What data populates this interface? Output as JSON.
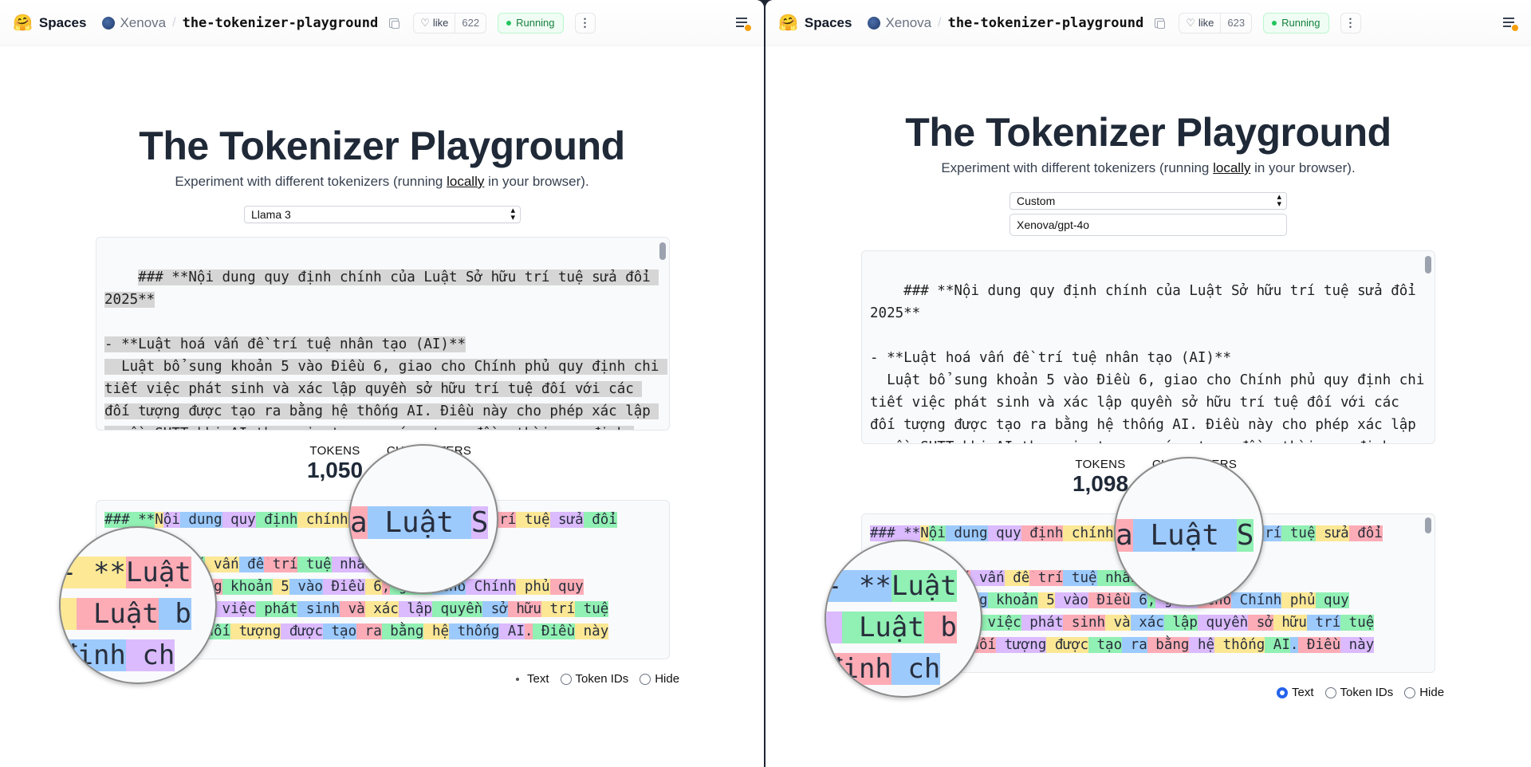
{
  "header": {
    "spaces": "Spaces",
    "org": "Xenova",
    "separator": "/",
    "repo": "the-tokenizer-playground",
    "like": "like",
    "status": "Running",
    "more": "⋮"
  },
  "left": {
    "like_count": "622",
    "model_select": "Llama 3",
    "tokens_value": "1,050",
    "magnifier_top_text": "a Luật S",
    "magnifier_left_lines": [
      "- **Luật",
      " Luật b",
      "định ch"
    ]
  },
  "right": {
    "like_count": "623",
    "model_select": "Custom",
    "custom_model": "Xenova/gpt-4o",
    "tokens_value": "1,098",
    "magnifier_top_text": "a Luật S",
    "magnifier_left_lines": [
      "- **Luật",
      " Luật b",
      "định ch"
    ]
  },
  "page": {
    "title": "The Tokenizer Playground",
    "subtitle_before": "Experiment with different tokenizers (running ",
    "subtitle_link": "locally",
    "subtitle_after": " in your browser).",
    "tokens_label": "TOKENS",
    "characters_label": "CHARACTERS",
    "radio_text": "Text",
    "radio_ids": "Token IDs",
    "radio_hide": "Hide"
  },
  "input_text": "### **Nội dung quy định chính của Luật Sở hữu trí tuệ sửa đổi 2025**\n\n- **Luật hoá vấn đề trí tuệ nhân tạo (AI)**\n  Luật bổ sung khoản 5 vào Điều 6, giao cho Chính phủ quy định chi tiết việc phát sinh và xác lập quyền sở hữu trí tuệ đối với các đối tượng được tạo ra bằng hệ thống AI. Điều này cho phép xác lập quyền SHTT khi AI tham gia tạo ra sáng tạo, đồng thời quy định việc sử dụng dữ liệu để huấn luyện AI.",
  "token_lines_left": [
    [
      [
        "### **",
        1
      ],
      [
        "N",
        2
      ],
      [
        "ội",
        4
      ],
      [
        " dung",
        3
      ],
      [
        " quy",
        4
      ],
      [
        " định",
        1
      ],
      [
        " chính",
        2
      ],
      [
        " của",
        0
      ],
      [
        " Luật",
        3
      ],
      [
        " Sở",
        4
      ],
      [
        " hữu",
        1
      ],
      [
        " trí",
        0
      ],
      [
        " tuệ",
        2
      ],
      [
        " sửa",
        4
      ],
      [
        " đổi",
        1
      ]
    ],
    [
      [
        "",
        0
      ]
    ],
    [
      [
        "- **",
        2
      ],
      [
        "Luật",
        0
      ],
      [
        " hoá",
        1
      ],
      [
        " vấn",
        2
      ],
      [
        " đề",
        3
      ],
      [
        " trí",
        0
      ],
      [
        " tuệ",
        1
      ],
      [
        " nhân",
        4
      ],
      [
        " tạo",
        2
      ],
      [
        " (AI",
        3
      ],
      [
        ")**",
        1
      ]
    ],
    [
      [
        "  Luật",
        3
      ],
      [
        " bổ",
        4
      ],
      [
        " sung",
        0
      ],
      [
        " khoản",
        1
      ],
      [
        " 5",
        2
      ],
      [
        " vào",
        3
      ],
      [
        " Điều",
        4
      ],
      [
        " 6",
        2
      ],
      [
        ",",
        0
      ],
      [
        " giao",
        1
      ],
      [
        " cho",
        3
      ],
      [
        " Chính",
        4
      ],
      [
        " phủ",
        2
      ],
      [
        " quy",
        0
      ]
    ],
    [
      [
        "định",
        3
      ],
      [
        " chi",
        1
      ],
      [
        " tiết",
        2
      ],
      [
        " việc",
        4
      ],
      [
        " phát",
        1
      ],
      [
        " sinh",
        3
      ],
      [
        " và",
        0
      ],
      [
        " xác",
        2
      ],
      [
        " lập",
        4
      ],
      [
        " quyền",
        1
      ],
      [
        " sở",
        3
      ],
      [
        " hữu",
        0
      ],
      [
        " trí",
        2
      ],
      [
        " tuệ",
        1
      ]
    ],
    [
      [
        "đối",
        4
      ],
      [
        " với",
        0
      ],
      [
        " các",
        3
      ],
      [
        " đối",
        1
      ],
      [
        " tượng",
        2
      ],
      [
        " được",
        4
      ],
      [
        " tạo",
        3
      ],
      [
        " ra",
        0
      ],
      [
        " bằng",
        1
      ],
      [
        " hệ",
        2
      ],
      [
        " thống",
        3
      ],
      [
        " AI",
        4
      ],
      [
        ".",
        0
      ],
      [
        " Điều",
        1
      ],
      [
        " này",
        2
      ]
    ]
  ],
  "token_lines_right": [
    [
      [
        "### **",
        4
      ],
      [
        "N",
        2
      ],
      [
        "ội",
        1
      ],
      [
        " dung",
        3
      ],
      [
        " quy",
        4
      ],
      [
        " định",
        0
      ],
      [
        " chính",
        2
      ],
      [
        " của",
        1
      ],
      [
        " Luật",
        3
      ],
      [
        " Sở",
        0
      ],
      [
        " hữu",
        4
      ],
      [
        " trí",
        3
      ],
      [
        " tuệ",
        1
      ],
      [
        " sửa",
        2
      ],
      [
        " đổi",
        0
      ]
    ],
    [
      [
        "",
        0
      ]
    ],
    [
      [
        "- **",
        3
      ],
      [
        "Luật",
        1
      ],
      [
        " hoá",
        0
      ],
      [
        " vấn",
        4
      ],
      [
        " đề",
        2
      ],
      [
        " trí",
        0
      ],
      [
        " tuệ",
        3
      ],
      [
        " nhân",
        1
      ],
      [
        " tạo",
        4
      ],
      [
        " (AI",
        2
      ],
      [
        ")**",
        3
      ]
    ],
    [
      [
        "  Luật",
        2
      ],
      [
        " bổ",
        0
      ],
      [
        " sung",
        3
      ],
      [
        " khoản",
        1
      ],
      [
        " 5",
        2
      ],
      [
        " vào",
        4
      ],
      [
        " Điều",
        0
      ],
      [
        " 6",
        3
      ],
      [
        ",",
        1
      ],
      [
        " giao",
        4
      ],
      [
        " cho",
        0
      ],
      [
        " Chính",
        3
      ],
      [
        " phủ",
        2
      ],
      [
        " quy",
        1
      ]
    ],
    [
      [
        "định",
        0
      ],
      [
        " chi",
        3
      ],
      [
        " tiết",
        2
      ],
      [
        " việc",
        1
      ],
      [
        " phát",
        4
      ],
      [
        " sinh",
        0
      ],
      [
        " và",
        2
      ],
      [
        " xác",
        3
      ],
      [
        " lập",
        1
      ],
      [
        " quyền",
        4
      ],
      [
        " sở",
        0
      ],
      [
        " hữu",
        2
      ],
      [
        " trí",
        3
      ],
      [
        " tuệ",
        1
      ]
    ],
    [
      [
        "đối",
        2
      ],
      [
        " với",
        3
      ],
      [
        " các",
        1
      ],
      [
        " đối",
        0
      ],
      [
        " tượng",
        4
      ],
      [
        " được",
        2
      ],
      [
        " tạo",
        1
      ],
      [
        " ra",
        3
      ],
      [
        " bằng",
        0
      ],
      [
        " hệ",
        4
      ],
      [
        " thống",
        2
      ],
      [
        " AI",
        1
      ],
      [
        ".",
        3
      ],
      [
        " Điều",
        0
      ],
      [
        " này",
        4
      ]
    ]
  ]
}
